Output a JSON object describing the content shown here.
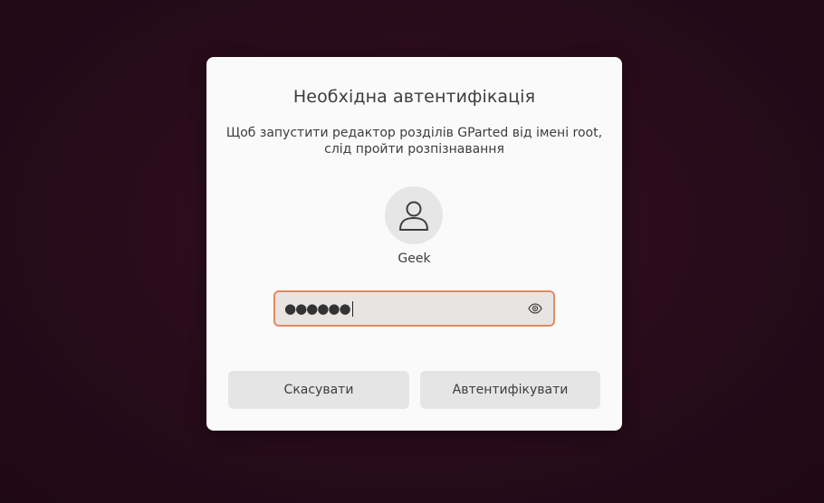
{
  "dialog": {
    "title": "Необхідна автентифікація",
    "message_line1": "Щоб запустити редактор розділів GParted від імені root,",
    "message_line2": "слід пройти розпізнавання",
    "username": "Geek",
    "password_mask": "●●●●●●",
    "cancel_label": "Скасувати",
    "authenticate_label": "Автентифікувати"
  },
  "icons": {
    "avatar": "user-icon",
    "reveal": "eye-icon"
  },
  "colors": {
    "focus_border": "#e28a62",
    "dialog_bg": "#fafafa",
    "button_bg": "#e5e5e5",
    "backdrop": "#2a0c1c"
  }
}
